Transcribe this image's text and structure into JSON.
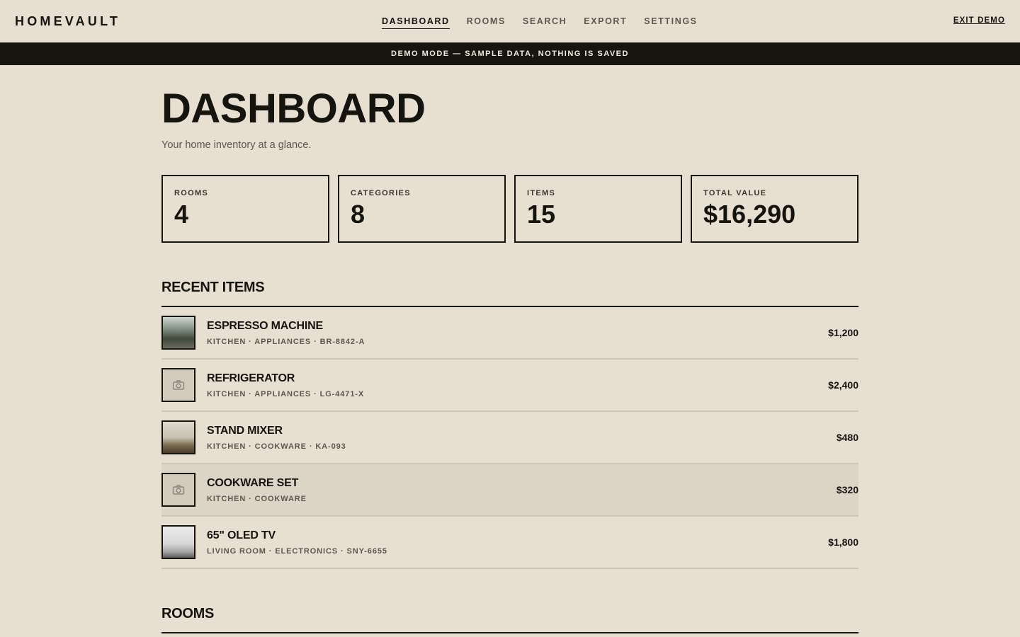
{
  "brand": "HOMEVAULT",
  "nav": [
    {
      "label": "DASHBOARD",
      "active": true
    },
    {
      "label": "ROOMS",
      "active": false
    },
    {
      "label": "SEARCH",
      "active": false
    },
    {
      "label": "EXPORT",
      "active": false
    },
    {
      "label": "SETTINGS",
      "active": false
    }
  ],
  "exit_label": "EXIT DEMO",
  "banner": "DEMO MODE — SAMPLE DATA, NOTHING IS SAVED",
  "page": {
    "title": "DASHBOARD",
    "subtitle": "Your home inventory at a glance."
  },
  "stats": [
    {
      "label": "ROOMS",
      "value": "4"
    },
    {
      "label": "CATEGORIES",
      "value": "8"
    },
    {
      "label": "ITEMS",
      "value": "15"
    },
    {
      "label": "TOTAL VALUE",
      "value": "$16,290"
    }
  ],
  "recent": {
    "heading": "RECENT ITEMS",
    "items": [
      {
        "name": "ESPRESSO MACHINE",
        "meta": "KITCHEN · APPLIANCES · BR-8842-A",
        "price": "$1,200",
        "thumb": "photo-thumbnail"
      },
      {
        "name": "REFRIGERATOR",
        "meta": "KITCHEN · APPLIANCES · LG-4471-X",
        "price": "$2,400",
        "thumb": "camera-icon"
      },
      {
        "name": "STAND MIXER",
        "meta": "KITCHEN · COOKWARE · KA-093",
        "price": "$480",
        "thumb": "photo-thumbnail"
      },
      {
        "name": "COOKWARE SET",
        "meta": "KITCHEN · COOKWARE",
        "price": "$320",
        "thumb": "camera-icon"
      },
      {
        "name": "65\" OLED TV",
        "meta": "LIVING ROOM · ELECTRONICS · SNY-6655",
        "price": "$1,800",
        "thumb": "photo-thumbnail"
      }
    ]
  },
  "rooms_heading": "ROOMS"
}
